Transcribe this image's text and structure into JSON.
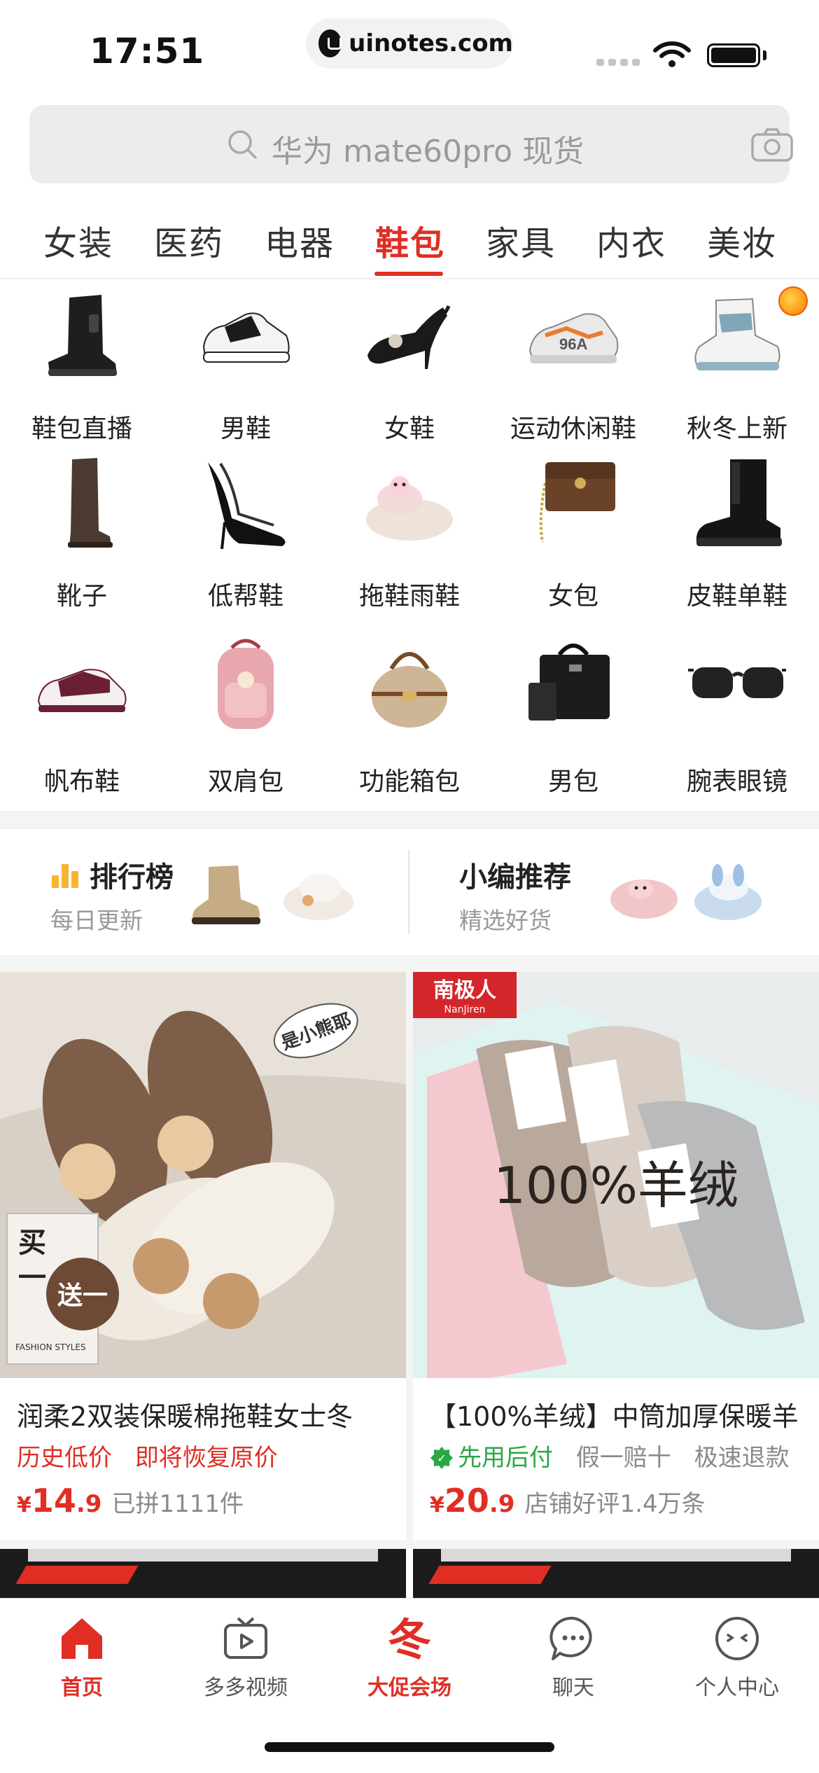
{
  "status_bar": {
    "time": "17:51",
    "url": "uinotes.com"
  },
  "search": {
    "placeholder": "华为 mate60pro 现货"
  },
  "tabs": [
    {
      "label": "女装",
      "active": false
    },
    {
      "label": "医药",
      "active": false
    },
    {
      "label": "电器",
      "active": false
    },
    {
      "label": "鞋包",
      "active": true
    },
    {
      "label": "家具",
      "active": false
    },
    {
      "label": "内衣",
      "active": false
    },
    {
      "label": "美妆",
      "active": false
    }
  ],
  "subcategories": [
    {
      "label": "鞋包直播",
      "icon": "boot-icon"
    },
    {
      "label": "男鞋",
      "icon": "sneaker-icon"
    },
    {
      "label": "女鞋",
      "icon": "heel-icon"
    },
    {
      "label": "运动休闲鞋",
      "icon": "sport-shoe-icon"
    },
    {
      "label": "秋冬上新",
      "icon": "high-top-icon"
    },
    {
      "label": "靴子",
      "icon": "tall-boot-icon"
    },
    {
      "label": "低帮鞋",
      "icon": "pump-icon"
    },
    {
      "label": "拖鞋雨鞋",
      "icon": "slipper-icon"
    },
    {
      "label": "女包",
      "icon": "handbag-icon"
    },
    {
      "label": "皮鞋单鞋",
      "icon": "leather-boot-icon"
    },
    {
      "label": "帆布鞋",
      "icon": "canvas-shoe-icon"
    },
    {
      "label": "双肩包",
      "icon": "backpack-icon"
    },
    {
      "label": "功能箱包",
      "icon": "round-bag-icon"
    },
    {
      "label": "男包",
      "icon": "briefcase-icon"
    },
    {
      "label": "腕表眼镜",
      "icon": "sunglasses-icon"
    }
  ],
  "ranking": {
    "title": "排行榜",
    "subtitle": "每日更新"
  },
  "editor_pick": {
    "title": "小编推荐",
    "subtitle": "精选好货"
  },
  "products": [
    {
      "title": "润柔2双装保暖棉拖鞋女士冬",
      "tags": [
        "历史低价",
        "即将恢复原价"
      ],
      "currency": "¥",
      "price_int": "14",
      "price_dec": ".9",
      "sales": "已拼1111件",
      "image_text": {
        "sticker": "是小熊耶",
        "promo_top": "买",
        "promo_mid": "一",
        "promo_circle": "送一",
        "caption": "FASHION STYLES"
      }
    },
    {
      "title": "【100%羊绒】中筒加厚保暖羊",
      "tags": [
        "先用后付",
        "假一赔十",
        "极速退款"
      ],
      "currency": "¥",
      "price_int": "20",
      "price_dec": ".9",
      "sales": "店铺好评1.4万条",
      "image_text": {
        "brand": "南极人",
        "brand_en": "NanJiren",
        "overlay": "100%羊绒"
      }
    }
  ],
  "bottom_nav": [
    {
      "label": "首页",
      "icon": "home-icon",
      "active": true
    },
    {
      "label": "多多视频",
      "icon": "tv-icon",
      "active": false
    },
    {
      "label": "大促会场",
      "icon": "winter-promo-icon",
      "active": true
    },
    {
      "label": "聊天",
      "icon": "chat-icon",
      "active": false
    },
    {
      "label": "个人中心",
      "icon": "profile-icon",
      "active": false
    }
  ],
  "colors": {
    "accent": "#e02e24",
    "muted": "#999999",
    "green": "#2aa845"
  }
}
